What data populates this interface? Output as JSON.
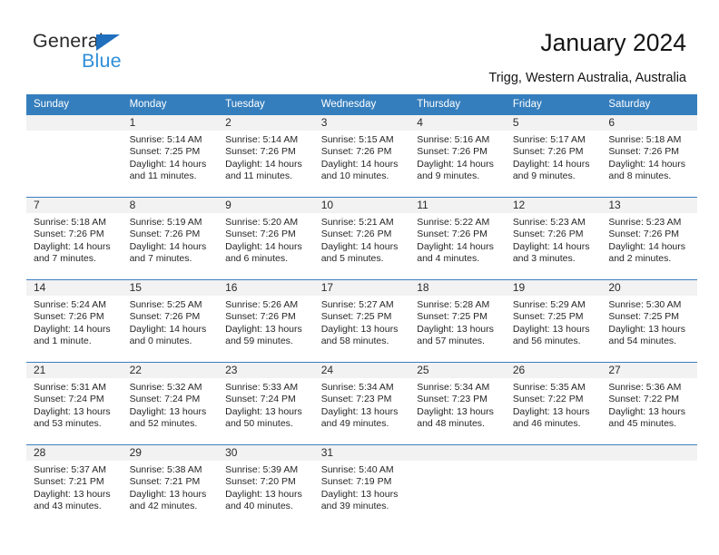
{
  "brand": {
    "name_top": "General",
    "name_bottom": "Blue",
    "triangle_color": "#1f6fbd",
    "blue_text_color": "#2e8fd9"
  },
  "header": {
    "title": "January 2024",
    "subtitle": "Trigg, Western Australia, Australia"
  },
  "theme": {
    "header_blue": "#357ebd",
    "row_line_blue": "#3a7fbe",
    "daynum_band": "#f2f2f2"
  },
  "calendar": {
    "weekday_headers": [
      "Sunday",
      "Monday",
      "Tuesday",
      "Wednesday",
      "Thursday",
      "Friday",
      "Saturday"
    ],
    "labels": {
      "sunrise": "Sunrise:",
      "sunset": "Sunset:",
      "daylight": "Daylight:"
    },
    "weeks": [
      [
        {
          "day": "",
          "blank": true
        },
        {
          "day": "1",
          "sunrise": "Sunrise: 5:14 AM",
          "sunset": "Sunset: 7:25 PM",
          "daylight1": "Daylight: 14 hours",
          "daylight2": "and 11 minutes."
        },
        {
          "day": "2",
          "sunrise": "Sunrise: 5:14 AM",
          "sunset": "Sunset: 7:26 PM",
          "daylight1": "Daylight: 14 hours",
          "daylight2": "and 11 minutes."
        },
        {
          "day": "3",
          "sunrise": "Sunrise: 5:15 AM",
          "sunset": "Sunset: 7:26 PM",
          "daylight1": "Daylight: 14 hours",
          "daylight2": "and 10 minutes."
        },
        {
          "day": "4",
          "sunrise": "Sunrise: 5:16 AM",
          "sunset": "Sunset: 7:26 PM",
          "daylight1": "Daylight: 14 hours",
          "daylight2": "and 9 minutes."
        },
        {
          "day": "5",
          "sunrise": "Sunrise: 5:17 AM",
          "sunset": "Sunset: 7:26 PM",
          "daylight1": "Daylight: 14 hours",
          "daylight2": "and 9 minutes."
        },
        {
          "day": "6",
          "sunrise": "Sunrise: 5:18 AM",
          "sunset": "Sunset: 7:26 PM",
          "daylight1": "Daylight: 14 hours",
          "daylight2": "and 8 minutes."
        }
      ],
      [
        {
          "day": "7",
          "sunrise": "Sunrise: 5:18 AM",
          "sunset": "Sunset: 7:26 PM",
          "daylight1": "Daylight: 14 hours",
          "daylight2": "and 7 minutes."
        },
        {
          "day": "8",
          "sunrise": "Sunrise: 5:19 AM",
          "sunset": "Sunset: 7:26 PM",
          "daylight1": "Daylight: 14 hours",
          "daylight2": "and 7 minutes."
        },
        {
          "day": "9",
          "sunrise": "Sunrise: 5:20 AM",
          "sunset": "Sunset: 7:26 PM",
          "daylight1": "Daylight: 14 hours",
          "daylight2": "and 6 minutes."
        },
        {
          "day": "10",
          "sunrise": "Sunrise: 5:21 AM",
          "sunset": "Sunset: 7:26 PM",
          "daylight1": "Daylight: 14 hours",
          "daylight2": "and 5 minutes."
        },
        {
          "day": "11",
          "sunrise": "Sunrise: 5:22 AM",
          "sunset": "Sunset: 7:26 PM",
          "daylight1": "Daylight: 14 hours",
          "daylight2": "and 4 minutes."
        },
        {
          "day": "12",
          "sunrise": "Sunrise: 5:23 AM",
          "sunset": "Sunset: 7:26 PM",
          "daylight1": "Daylight: 14 hours",
          "daylight2": "and 3 minutes."
        },
        {
          "day": "13",
          "sunrise": "Sunrise: 5:23 AM",
          "sunset": "Sunset: 7:26 PM",
          "daylight1": "Daylight: 14 hours",
          "daylight2": "and 2 minutes."
        }
      ],
      [
        {
          "day": "14",
          "sunrise": "Sunrise: 5:24 AM",
          "sunset": "Sunset: 7:26 PM",
          "daylight1": "Daylight: 14 hours",
          "daylight2": "and 1 minute."
        },
        {
          "day": "15",
          "sunrise": "Sunrise: 5:25 AM",
          "sunset": "Sunset: 7:26 PM",
          "daylight1": "Daylight: 14 hours",
          "daylight2": "and 0 minutes."
        },
        {
          "day": "16",
          "sunrise": "Sunrise: 5:26 AM",
          "sunset": "Sunset: 7:26 PM",
          "daylight1": "Daylight: 13 hours",
          "daylight2": "and 59 minutes."
        },
        {
          "day": "17",
          "sunrise": "Sunrise: 5:27 AM",
          "sunset": "Sunset: 7:25 PM",
          "daylight1": "Daylight: 13 hours",
          "daylight2": "and 58 minutes."
        },
        {
          "day": "18",
          "sunrise": "Sunrise: 5:28 AM",
          "sunset": "Sunset: 7:25 PM",
          "daylight1": "Daylight: 13 hours",
          "daylight2": "and 57 minutes."
        },
        {
          "day": "19",
          "sunrise": "Sunrise: 5:29 AM",
          "sunset": "Sunset: 7:25 PM",
          "daylight1": "Daylight: 13 hours",
          "daylight2": "and 56 minutes."
        },
        {
          "day": "20",
          "sunrise": "Sunrise: 5:30 AM",
          "sunset": "Sunset: 7:25 PM",
          "daylight1": "Daylight: 13 hours",
          "daylight2": "and 54 minutes."
        }
      ],
      [
        {
          "day": "21",
          "sunrise": "Sunrise: 5:31 AM",
          "sunset": "Sunset: 7:24 PM",
          "daylight1": "Daylight: 13 hours",
          "daylight2": "and 53 minutes."
        },
        {
          "day": "22",
          "sunrise": "Sunrise: 5:32 AM",
          "sunset": "Sunset: 7:24 PM",
          "daylight1": "Daylight: 13 hours",
          "daylight2": "and 52 minutes."
        },
        {
          "day": "23",
          "sunrise": "Sunrise: 5:33 AM",
          "sunset": "Sunset: 7:24 PM",
          "daylight1": "Daylight: 13 hours",
          "daylight2": "and 50 minutes."
        },
        {
          "day": "24",
          "sunrise": "Sunrise: 5:34 AM",
          "sunset": "Sunset: 7:23 PM",
          "daylight1": "Daylight: 13 hours",
          "daylight2": "and 49 minutes."
        },
        {
          "day": "25",
          "sunrise": "Sunrise: 5:34 AM",
          "sunset": "Sunset: 7:23 PM",
          "daylight1": "Daylight: 13 hours",
          "daylight2": "and 48 minutes."
        },
        {
          "day": "26",
          "sunrise": "Sunrise: 5:35 AM",
          "sunset": "Sunset: 7:22 PM",
          "daylight1": "Daylight: 13 hours",
          "daylight2": "and 46 minutes."
        },
        {
          "day": "27",
          "sunrise": "Sunrise: 5:36 AM",
          "sunset": "Sunset: 7:22 PM",
          "daylight1": "Daylight: 13 hours",
          "daylight2": "and 45 minutes."
        }
      ],
      [
        {
          "day": "28",
          "sunrise": "Sunrise: 5:37 AM",
          "sunset": "Sunset: 7:21 PM",
          "daylight1": "Daylight: 13 hours",
          "daylight2": "and 43 minutes."
        },
        {
          "day": "29",
          "sunrise": "Sunrise: 5:38 AM",
          "sunset": "Sunset: 7:21 PM",
          "daylight1": "Daylight: 13 hours",
          "daylight2": "and 42 minutes."
        },
        {
          "day": "30",
          "sunrise": "Sunrise: 5:39 AM",
          "sunset": "Sunset: 7:20 PM",
          "daylight1": "Daylight: 13 hours",
          "daylight2": "and 40 minutes."
        },
        {
          "day": "31",
          "sunrise": "Sunrise: 5:40 AM",
          "sunset": "Sunset: 7:19 PM",
          "daylight1": "Daylight: 13 hours",
          "daylight2": "and 39 minutes."
        },
        {
          "day": "",
          "blank": true
        },
        {
          "day": "",
          "blank": true
        },
        {
          "day": "",
          "blank": true
        }
      ]
    ]
  }
}
